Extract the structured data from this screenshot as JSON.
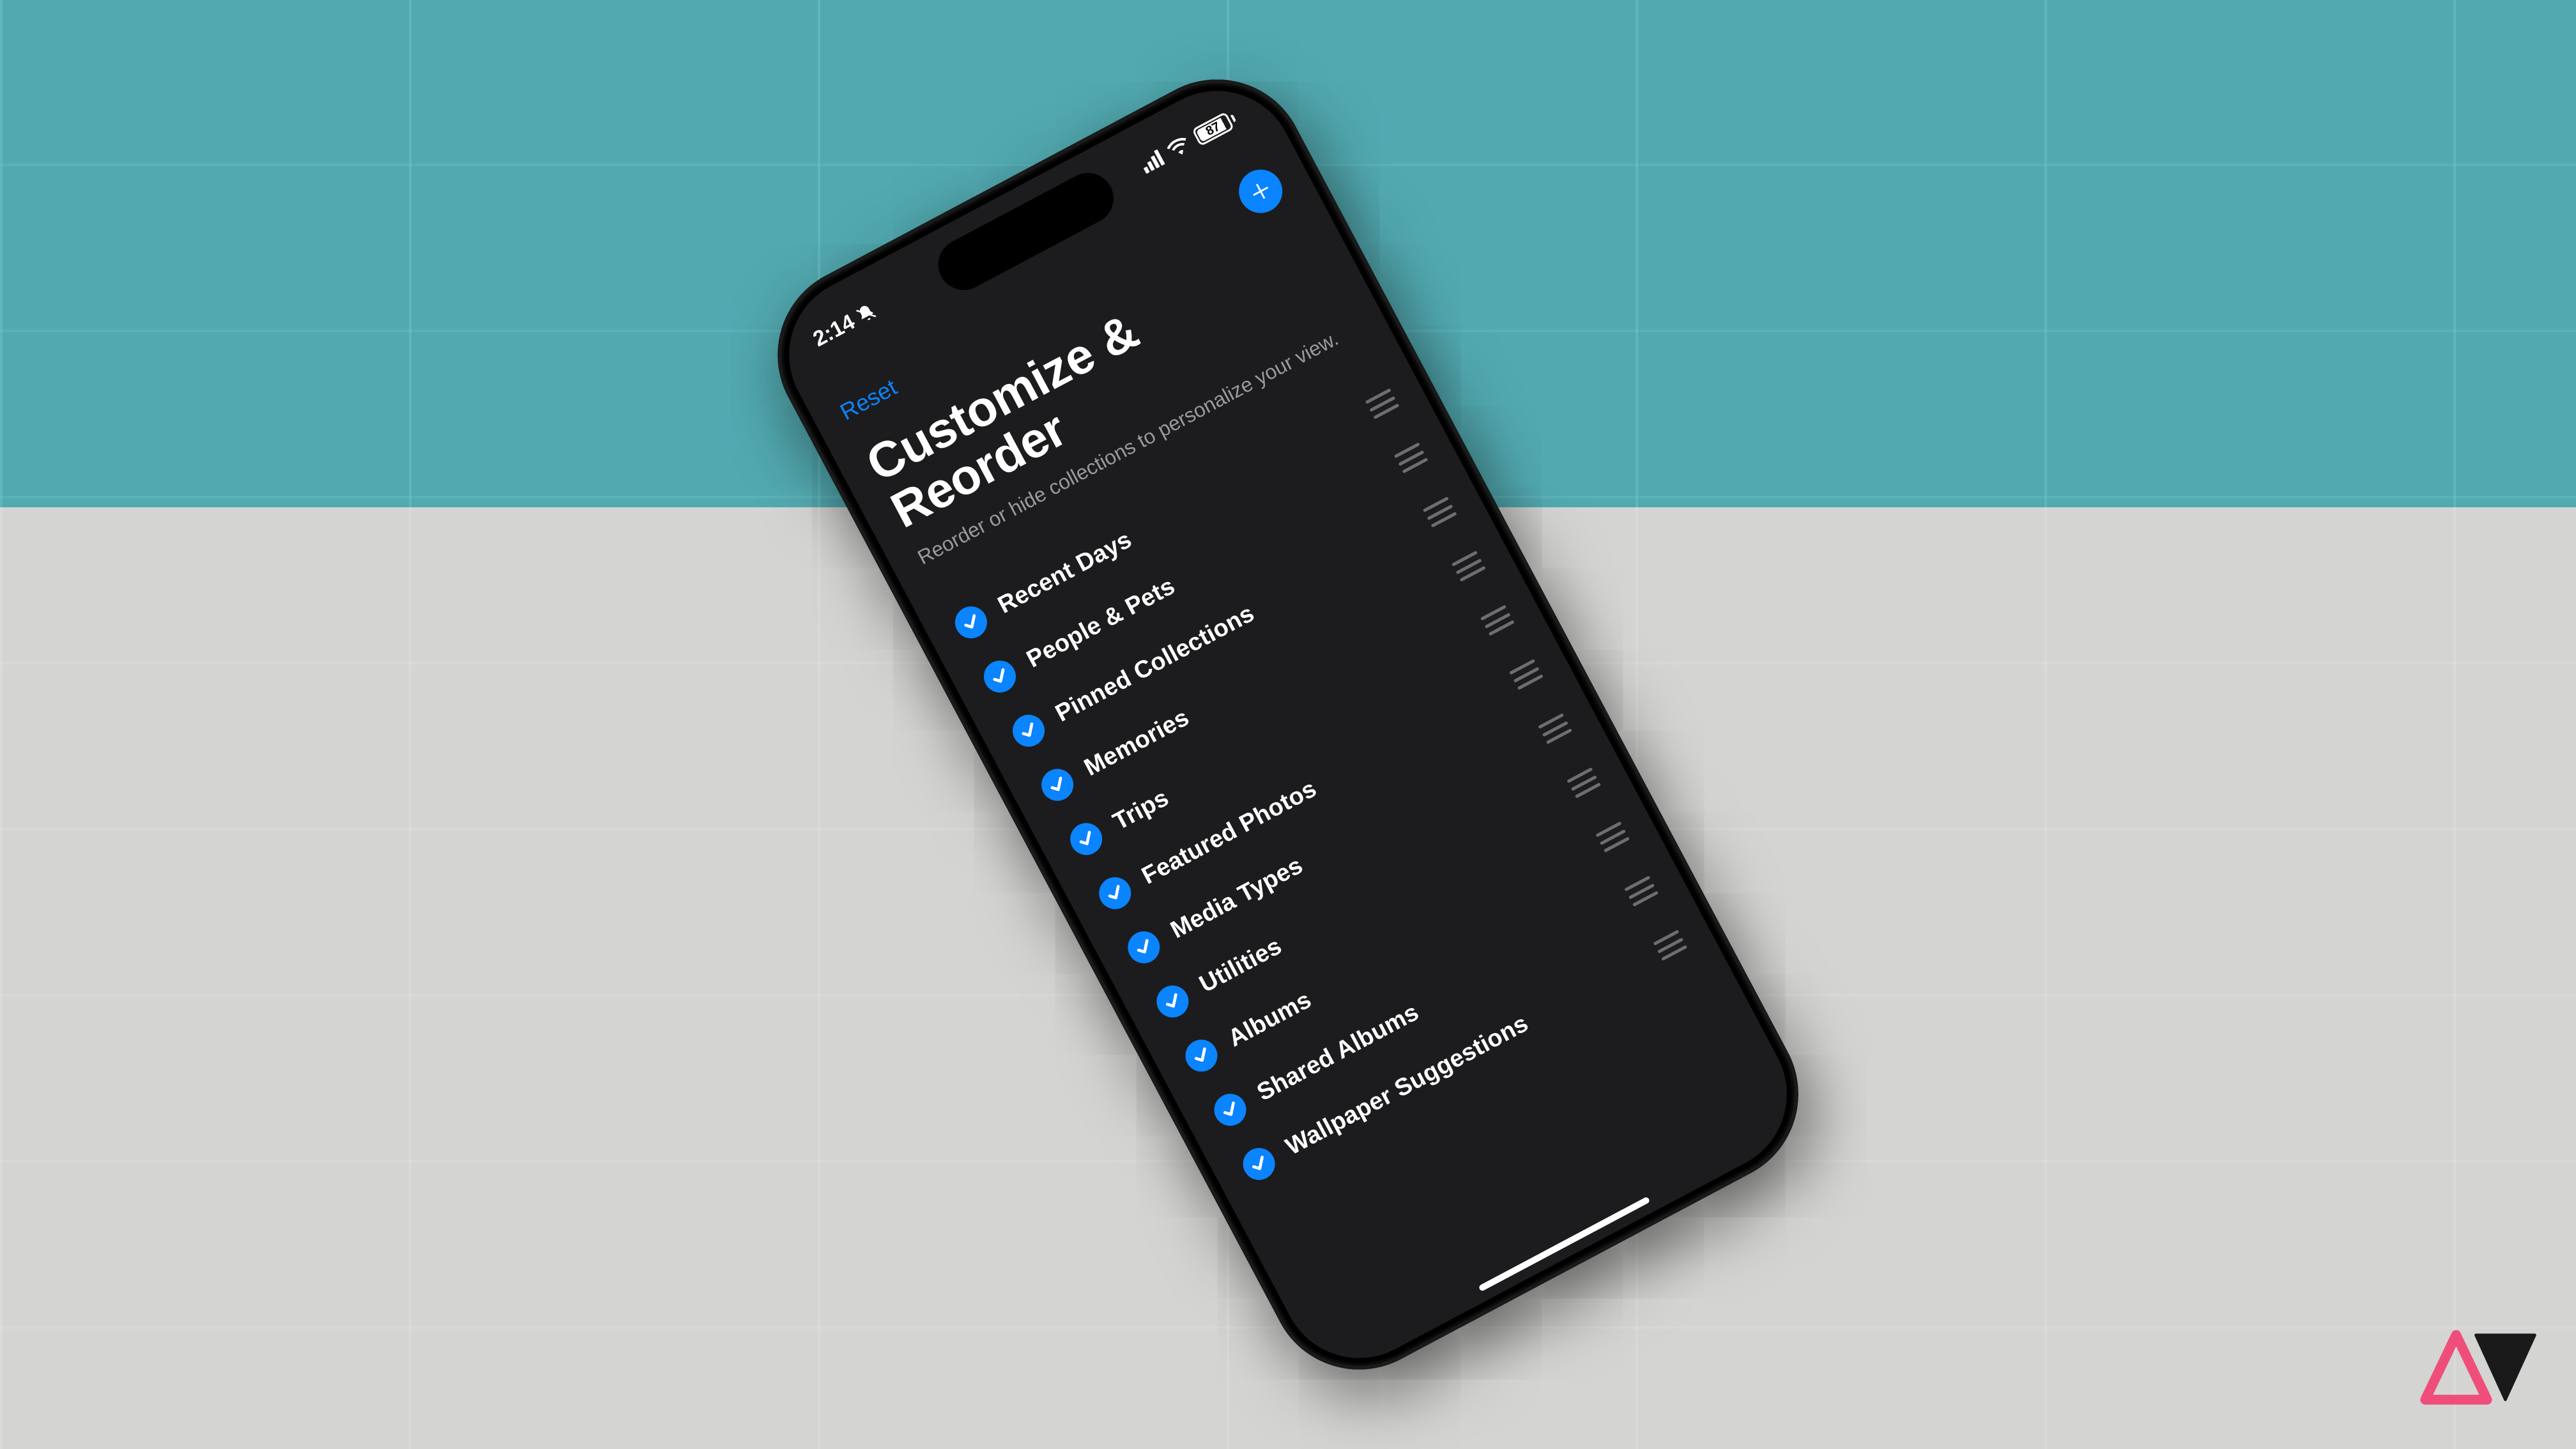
{
  "status": {
    "time": "2:14",
    "battery_percent": "87"
  },
  "nav": {
    "reset_label": "Reset"
  },
  "header": {
    "title_line1": "Customize &",
    "title_line2": "Reorder",
    "subtitle": "Reorder or hide collections to personalize your view."
  },
  "list": {
    "items": [
      {
        "label": "Recent Days"
      },
      {
        "label": "People & Pets"
      },
      {
        "label": "Pinned Collections"
      },
      {
        "label": "Memories"
      },
      {
        "label": "Trips"
      },
      {
        "label": "Featured Photos"
      },
      {
        "label": "Media Types"
      },
      {
        "label": "Utilities"
      },
      {
        "label": "Albums"
      },
      {
        "label": "Shared Albums"
      },
      {
        "label": "Wallpaper Suggestions"
      }
    ]
  }
}
